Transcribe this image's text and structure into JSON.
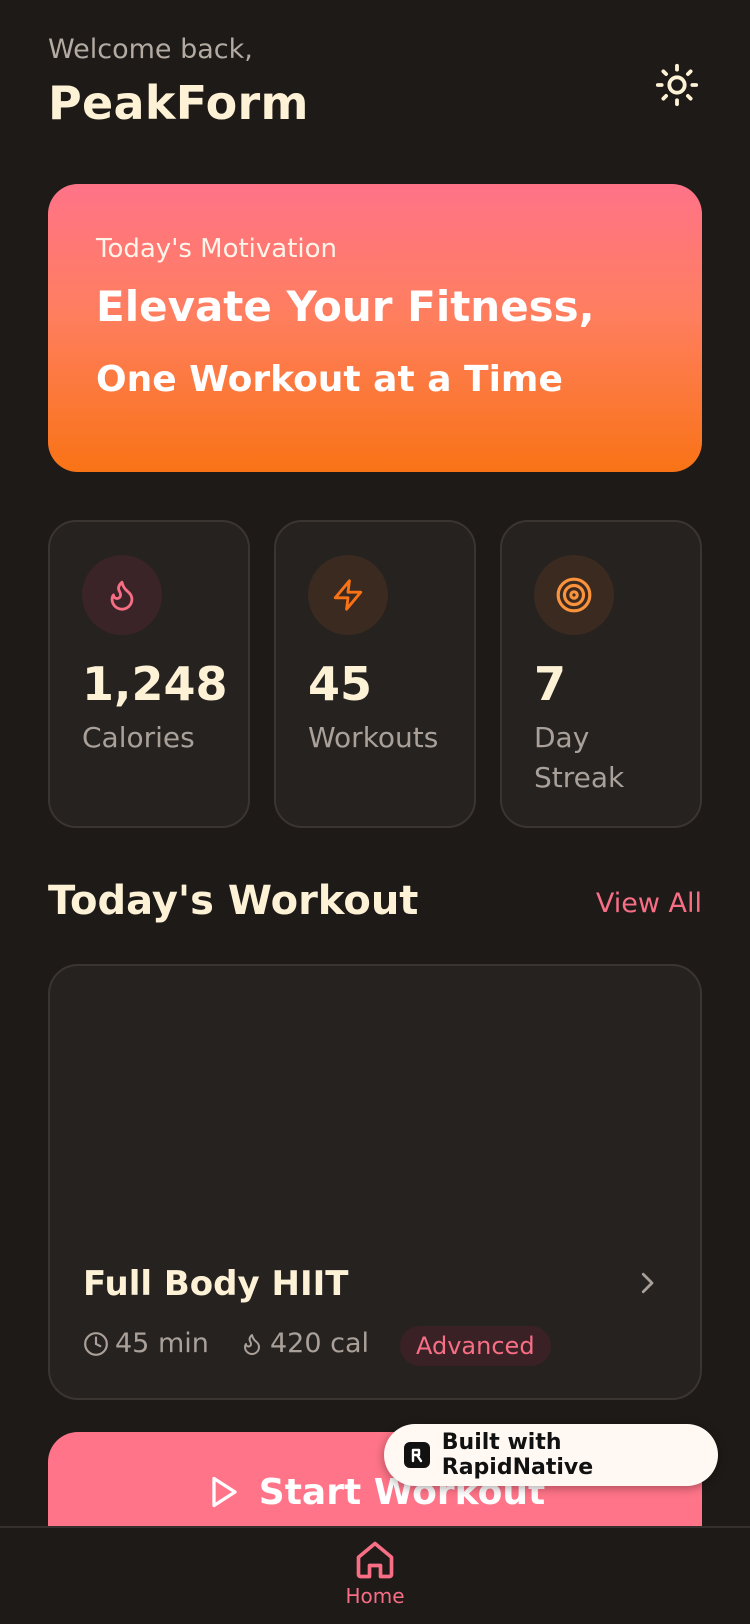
{
  "header": {
    "welcome": "Welcome back,",
    "brand": "PeakForm",
    "theme_icon": "sun-icon"
  },
  "hero": {
    "eyebrow": "Today's Motivation",
    "line1": "Elevate Your Fitness,",
    "line2": "One Workout at a Time"
  },
  "stats": [
    {
      "icon": "flame-icon",
      "value": "1,248",
      "label": "Calories",
      "color": "#f76e85"
    },
    {
      "icon": "lightning-icon",
      "value": "45",
      "label": "Workouts",
      "color": "#f97316"
    },
    {
      "icon": "target-icon",
      "value": "7",
      "label": "Day Streak",
      "color": "#fb923c"
    }
  ],
  "section": {
    "title": "Today's Workout",
    "view_all": "View All"
  },
  "workout": {
    "name": "Full Body HIIT",
    "duration": "45 min",
    "calories": "420 cal",
    "level": "Advanced"
  },
  "start_button": {
    "label": "Start Workout"
  },
  "builtwith": {
    "label": "Built with RapidNative"
  },
  "nav": {
    "home_label": "Home"
  },
  "colors": {
    "background": "#1e1a18",
    "card": "#262220",
    "accent_pink": "#ff7488",
    "accent_orange": "#f97316",
    "text_cream": "#fdf1d6"
  }
}
